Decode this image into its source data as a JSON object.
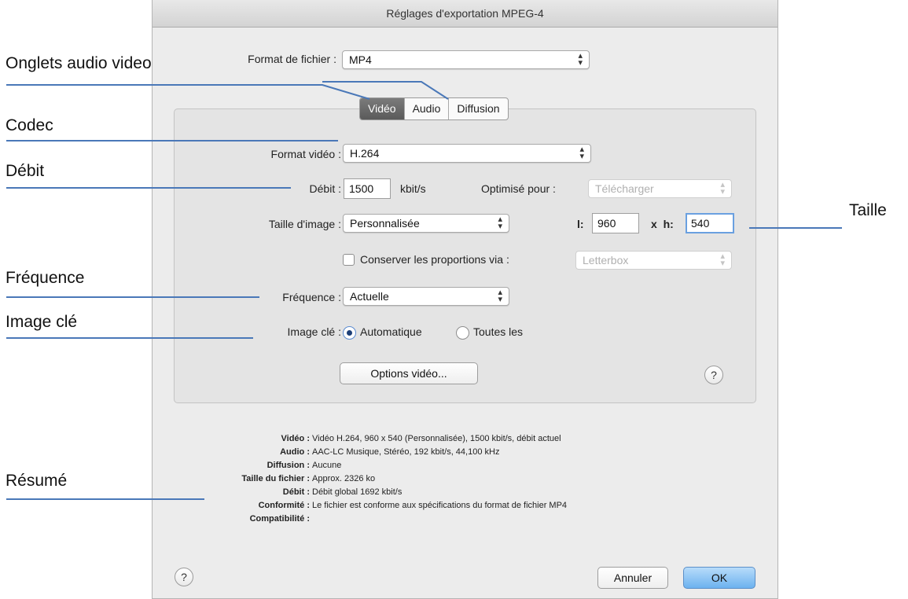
{
  "window": {
    "title": "Réglages d'exportation MPEG-4"
  },
  "file_format": {
    "label": "Format de fichier :",
    "value": "MP4"
  },
  "tabs": [
    {
      "label": "Vidéo",
      "active": true
    },
    {
      "label": "Audio",
      "active": false
    },
    {
      "label": "Diffusion",
      "active": false
    }
  ],
  "video": {
    "format_label": "Format vidéo :",
    "format_value": "H.264",
    "bitrate_label": "Débit :",
    "bitrate_value": "1500",
    "bitrate_unit": "kbit/s",
    "optimize_label": "Optimisé pour :",
    "optimize_value": "Télécharger",
    "size_label": "Taille d'image :",
    "size_value": "Personnalisée",
    "width_label": "l:",
    "width_value": "960",
    "height_label": "x  h:",
    "height_value": "540",
    "preserve_label": "Conserver les proportions via :",
    "preserve_value": "Letterbox",
    "framerate_label": "Fréquence :",
    "framerate_value": "Actuelle",
    "keyframe_label": "Image clé :",
    "keyframe_auto": "Automatique",
    "keyframe_every": "Toutes les",
    "options_button": "Options vidéo..."
  },
  "summary": [
    {
      "key": "Vidéo :",
      "value": "Vidéo H.264, 960 x 540 (Personnalisée), 1500 kbit/s, débit actuel"
    },
    {
      "key": "Audio :",
      "value": "AAC-LC Musique, Stéréo, 192 kbit/s, 44,100 kHz"
    },
    {
      "key": "Diffusion :",
      "value": "Aucune"
    },
    {
      "key": "Taille du fichier :",
      "value": "Approx. 2326 ko"
    },
    {
      "key": "Débit :",
      "value": "Débit global 1692 kbit/s"
    },
    {
      "key": "Conformité :",
      "value": "Le fichier est conforme aux spécifications du format de fichier MP4"
    },
    {
      "key": "Compatibilité :",
      "value": ""
    }
  ],
  "buttons": {
    "help": "?",
    "cancel": "Annuler",
    "ok": "OK"
  },
  "annotations": {
    "tabs": "Onglets audio video",
    "codec": "Codec",
    "bitrate": "Débit",
    "size": "Taille",
    "framerate": "Fréquence",
    "keyframe": "Image clé",
    "summary": "Résumé"
  },
  "colors": {
    "annotation_line": "#4a78b8",
    "ok_button": "#6cb2ef",
    "active_tab": "#666666"
  }
}
